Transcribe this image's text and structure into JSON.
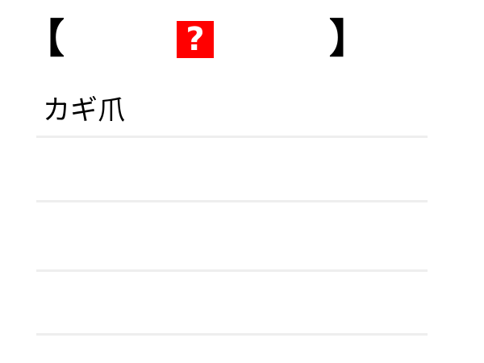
{
  "header": {
    "left_bracket": "【",
    "right_bracket": "】",
    "help_icon": "help-icon",
    "help_glyph": "?",
    "help_background": "#ff0000"
  },
  "list": {
    "items": [
      {
        "label": "カギ爪"
      },
      {
        "label": ""
      },
      {
        "label": ""
      },
      {
        "label": ""
      }
    ]
  }
}
